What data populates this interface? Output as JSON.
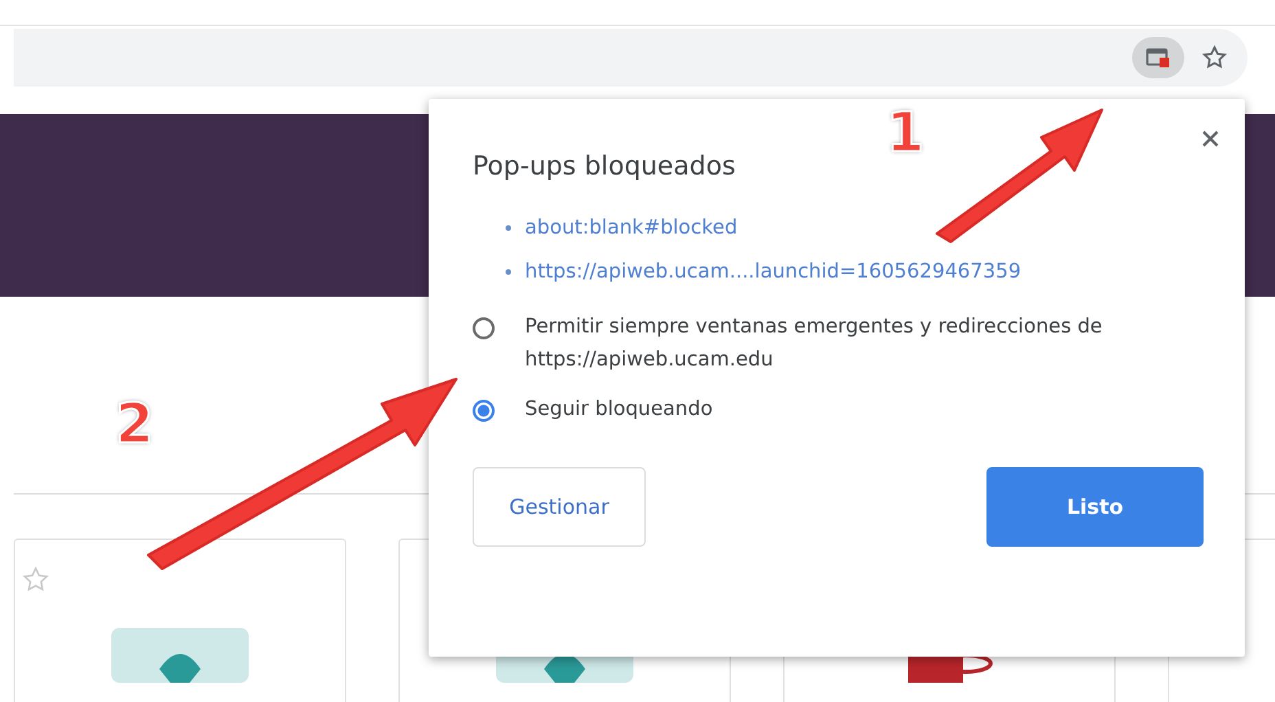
{
  "popup": {
    "title": "Pop-ups bloqueados",
    "blocked_links": [
      "about:blank#blocked",
      "https://apiweb.ucam....launchid=1605629467359"
    ],
    "options": [
      {
        "label": "Permitir siempre ventanas emergentes y redirecciones de https://apiweb.ucam.edu",
        "selected": false
      },
      {
        "label": "Seguir bloqueando",
        "selected": true
      }
    ],
    "buttons": [
      {
        "label": "Gestionar",
        "kind": "secondary"
      },
      {
        "label": "Listo",
        "kind": "primary"
      }
    ]
  },
  "annotations": [
    {
      "label": "1"
    },
    {
      "label": "2"
    }
  ],
  "cards": [
    {
      "kind": "star"
    },
    {
      "kind": "teal"
    },
    {
      "kind": "red"
    },
    {
      "kind": "blank"
    }
  ]
}
